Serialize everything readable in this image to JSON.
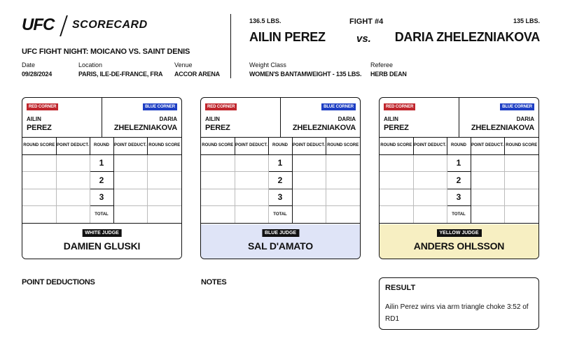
{
  "header": {
    "logo": "UFC",
    "title": "SCORECARD",
    "event": "UFC FIGHT NIGHT: MOICANO VS. SAINT DENIS",
    "date_label": "Date",
    "date": "09/28/2024",
    "location_label": "Location",
    "location": "PARIS, ILE-DE-FRANCE, FRA",
    "venue_label": "Venue",
    "venue": "ACCOR ARENA"
  },
  "fight": {
    "number": "FIGHT #4",
    "vs": "vs.",
    "fighter_a": {
      "weight": "136.5 LBS.",
      "name": "AILIN PEREZ",
      "first": "AILIN",
      "last": "PEREZ"
    },
    "fighter_b": {
      "weight": "135 LBS.",
      "name": "DARIA ZHELEZNIAKOVA",
      "first": "DARIA",
      "last": "ZHELEZNIAKOVA"
    },
    "weight_class_label": "Weight Class",
    "weight_class": "WOMEN'S BANTAMWEIGHT - 135 LBS.",
    "referee_label": "Referee",
    "referee": "HERB DEAN"
  },
  "card_labels": {
    "red_corner": "RED CORNER",
    "blue_corner": "BLUE CORNER",
    "round_score": "ROUND SCORE",
    "point_deduct": "POINT DEDUCT.",
    "round": "ROUND",
    "total": "TOTAL",
    "rounds": [
      "1",
      "2",
      "3"
    ]
  },
  "judges": [
    {
      "role": "WHITE JUDGE",
      "name": "DAMIEN GLUSKI",
      "color": "#ffffff"
    },
    {
      "role": "BLUE JUDGE",
      "name": "SAL D'AMATO",
      "color": "#dfe4f7"
    },
    {
      "role": "YELLOW JUDGE",
      "name": "ANDERS OHLSSON",
      "color": "#f7efc2"
    }
  ],
  "colors": {
    "red_corner": "#c0262d",
    "blue_corner": "#1e3fc4"
  },
  "sections": {
    "point_deductions": "POINT DEDUCTIONS",
    "notes": "NOTES",
    "result_title": "RESULT",
    "result_text": "Ailin Perez wins via arm triangle choke 3:52 of RD1"
  }
}
